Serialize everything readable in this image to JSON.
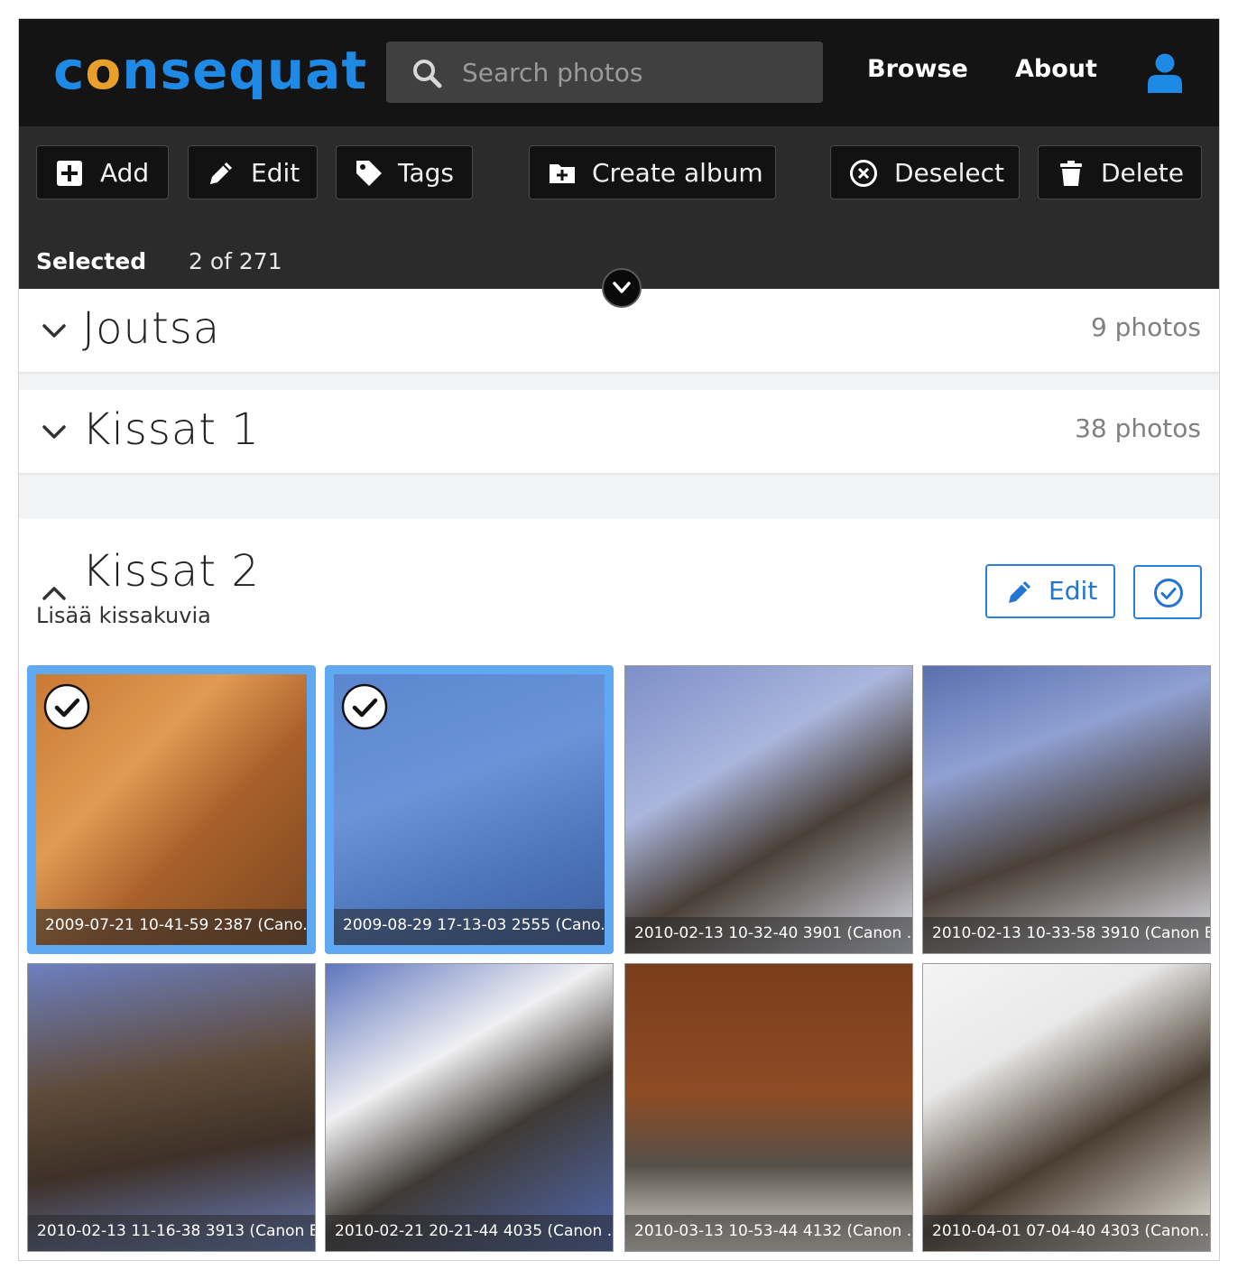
{
  "nav": {
    "logo_pre": "c",
    "logo_o": "o",
    "logo_post": "nsequat",
    "search_placeholder": "Search photos",
    "browse": "Browse",
    "about": "About"
  },
  "toolbar": {
    "add": "Add",
    "edit": "Edit",
    "tags": "Tags",
    "create_album": "Create album",
    "deselect": "Deselect",
    "delete": "Delete",
    "selected_label": "Selected",
    "selected_count": "2 of 271"
  },
  "albums": [
    {
      "title": "Joutsa",
      "count": "9 photos"
    },
    {
      "title": "Kissat 1",
      "count": "38 photos"
    },
    {
      "title": "Kissat 2",
      "description": "Lisää kissakuvia",
      "edit_label": "Edit"
    }
  ],
  "photos": [
    {
      "caption": "2009-07-21 10-41-59 2387 (Cano...",
      "selected": true
    },
    {
      "caption": "2009-08-29 17-13-03 2555 (Cano...",
      "selected": true
    },
    {
      "caption": "2010-02-13 10-32-40 3901 (Canon ...",
      "selected": false
    },
    {
      "caption": "2010-02-13 10-33-58 3910 (Canon E...",
      "selected": false
    },
    {
      "caption": "2010-02-13 11-16-38 3913 (Canon E...",
      "selected": false
    },
    {
      "caption": "2010-02-21 20-21-44 4035 (Canon ...",
      "selected": false
    },
    {
      "caption": "2010-03-13 10-53-44 4132 (Canon ...",
      "selected": false
    },
    {
      "caption": "2010-04-01 07-04-40 4303 (Canon...",
      "selected": false
    }
  ],
  "colors": {
    "brand_blue": "#1e8ae6",
    "brand_orange": "#e8a02b",
    "selection": "#5fa9f2",
    "toolbar_bg": "#2b2b2c",
    "nav_bg": "#141414"
  }
}
